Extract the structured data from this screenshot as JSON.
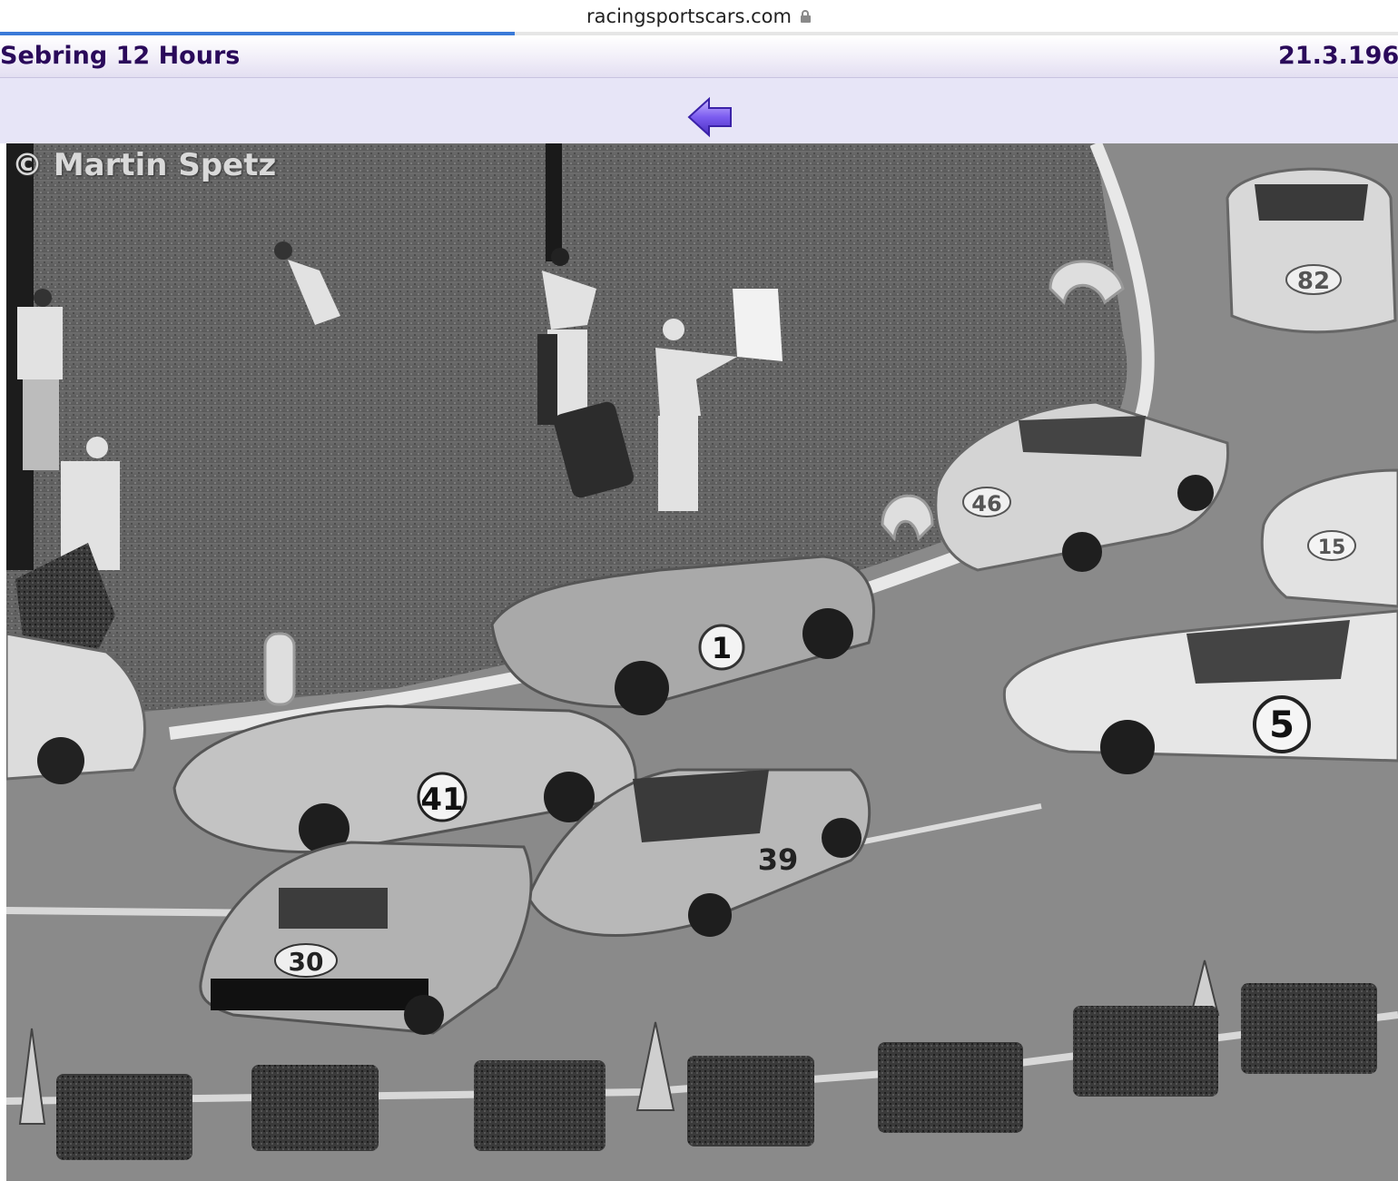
{
  "browser": {
    "url": "racingsportscars.com",
    "load_progress_fraction": 0.368
  },
  "header": {
    "event": "Sebring 12 Hours",
    "date": "21.3.196"
  },
  "nav": {
    "back_icon": "back-arrow-icon",
    "arrow_color": "#7b5cf0"
  },
  "photo": {
    "credit": "© Martin Spetz",
    "car_numbers": [
      "82",
      "46",
      "15",
      "1",
      "5",
      "41",
      "39",
      "30"
    ]
  }
}
